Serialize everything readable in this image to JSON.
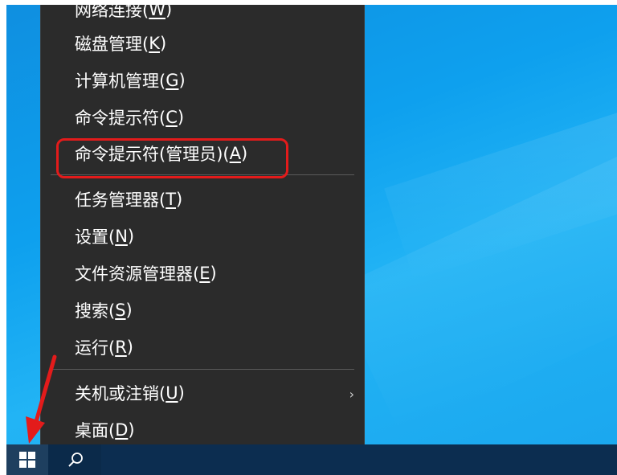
{
  "menu": {
    "items": [
      {
        "text": "网络连接(",
        "key": "W",
        "end": ")"
      },
      {
        "text": "磁盘管理(",
        "key": "K",
        "end": ")"
      },
      {
        "text": "计算机管理(",
        "key": "G",
        "end": ")"
      },
      {
        "text": "命令提示符(",
        "key": "C",
        "end": ")"
      },
      {
        "text": "命令提示符(管理员)(",
        "key": "A",
        "end": ")"
      },
      {
        "text": "任务管理器(",
        "key": "T",
        "end": ")"
      },
      {
        "text": "设置(",
        "key": "N",
        "end": ")"
      },
      {
        "text": "文件资源管理器(",
        "key": "E",
        "end": ")"
      },
      {
        "text": "搜索(",
        "key": "S",
        "end": ")"
      },
      {
        "text": "运行(",
        "key": "R",
        "end": ")"
      },
      {
        "text": "关机或注销(",
        "key": "U",
        "end": ")"
      },
      {
        "text": "桌面(",
        "key": "D",
        "end": ")"
      }
    ],
    "submenu_indicator": "›",
    "highlighted_item_index": 4
  },
  "taskbar": {
    "start_icon": "windows-logo-icon",
    "search_icon": "search-icon"
  },
  "colors": {
    "menu_bg": "#2b2b2b",
    "highlight": "#e31b1b",
    "desktop": "#0ea0ee",
    "taskbar": "#0b2a4a"
  }
}
